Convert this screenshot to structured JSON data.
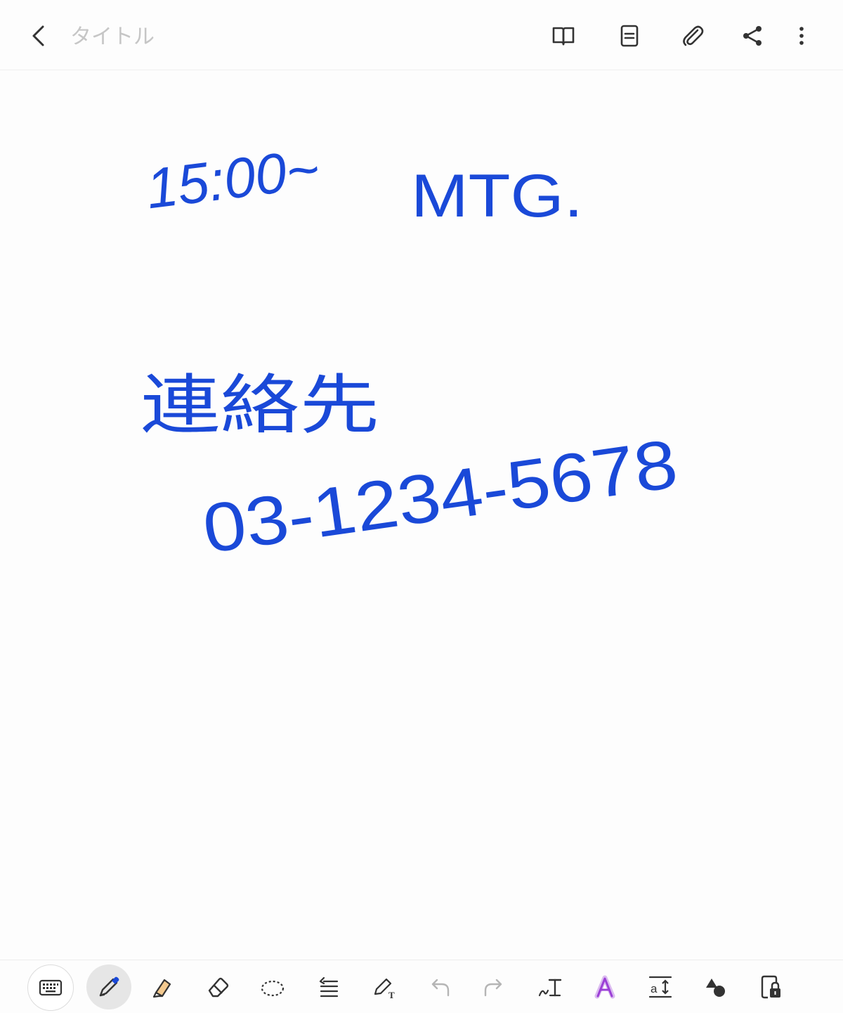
{
  "header": {
    "title_placeholder": "タイトル",
    "title_value": ""
  },
  "note": {
    "handwriting": [
      "15:00~",
      "MTG.",
      "連絡先",
      "03-1234-5678"
    ],
    "ink_color": "#1a49d8"
  },
  "icons": {
    "top": [
      "back-icon",
      "book-icon",
      "page-icon",
      "attach-icon",
      "share-icon",
      "more-icon"
    ],
    "tools": [
      "keyboard-icon",
      "pen-icon",
      "highlighter-icon",
      "eraser-icon",
      "lasso-icon",
      "line-spacing-icon",
      "pen-to-text-icon",
      "undo-icon",
      "redo-icon",
      "handwriting-to-text-icon",
      "text-style-icon",
      "text-resize-icon",
      "shapes-icon",
      "lock-icon"
    ]
  },
  "colors": {
    "icon": "#333333",
    "disabled_icon": "#b5b5b5",
    "highlighter": "#f3c98f",
    "pen_tip": "#1a49d8",
    "text_style_purple": "#9b3fd6"
  }
}
